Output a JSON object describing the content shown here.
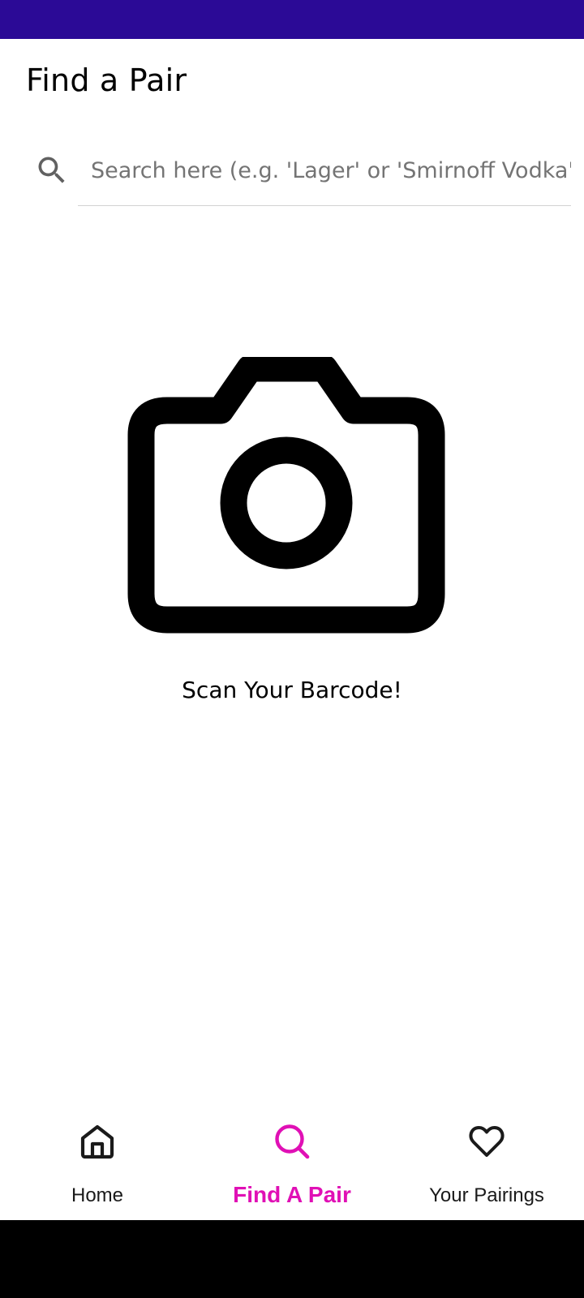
{
  "colors": {
    "status_bar": "#2b0a96",
    "accent": "#e010b5",
    "text": "#000000",
    "placeholder": "#747474",
    "system_nav": "#000000"
  },
  "header": {
    "title": "Find a Pair"
  },
  "search": {
    "icon": "search-icon",
    "value": "",
    "placeholder": "Search here (e.g. 'Lager' or 'Smirnoff Vodka')"
  },
  "scanner": {
    "icon": "camera-icon",
    "label": "Scan Your Barcode!"
  },
  "bottom_nav": {
    "active": "find-a-pair",
    "items": [
      {
        "id": "home",
        "icon": "home-icon",
        "label": "Home"
      },
      {
        "id": "find-a-pair",
        "icon": "search-icon",
        "label": "Find A Pair"
      },
      {
        "id": "your-pairings",
        "icon": "heart-icon",
        "label": "Your Pairings"
      }
    ]
  }
}
